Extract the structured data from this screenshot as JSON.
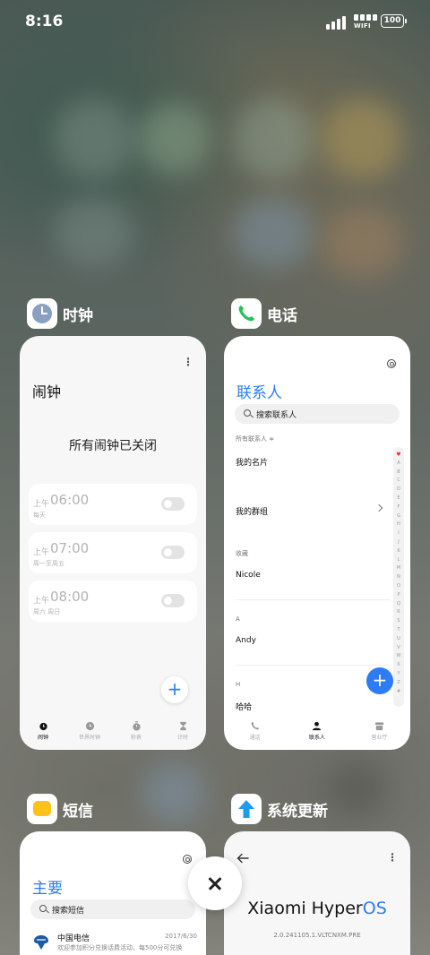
{
  "status_bar": {
    "time": "8:16",
    "wifi_label": "WIFI",
    "battery": "100"
  },
  "apps": [
    {
      "name": "时钟",
      "title": "闹钟",
      "empty_state": "所有闹钟已关闭",
      "alarms": [
        {
          "ampm": "上午",
          "time": "06:00",
          "repeat": "每天",
          "enabled": false
        },
        {
          "ampm": "上午",
          "time": "07:00",
          "repeat": "周一至周五",
          "enabled": false
        },
        {
          "ampm": "上午",
          "time": "08:00",
          "repeat": "周六 周日",
          "enabled": false
        }
      ],
      "fab": "+",
      "tabs": [
        "闹钟",
        "世界时钟",
        "秒表",
        "计时"
      ],
      "active_tab": "闹钟"
    },
    {
      "name": "电话",
      "title": "联系人",
      "search_placeholder": "搜索联系人",
      "filter": "所有联系人 ≑",
      "my_card": "我的名片",
      "my_groups": "我的群组",
      "sections": [
        {
          "header": "收藏",
          "contact": "Nicole"
        },
        {
          "header": "A",
          "contact": "Andy"
        },
        {
          "header": "H",
          "contact": "哈哈"
        }
      ],
      "alphabet": [
        "♥",
        "A",
        "B",
        "C",
        "D",
        "E",
        "F",
        "G",
        "H",
        "I",
        "J",
        "K",
        "L",
        "M",
        "N",
        "O",
        "P",
        "Q",
        "R",
        "S",
        "T",
        "U",
        "V",
        "W",
        "X",
        "Y",
        "Z",
        "#"
      ],
      "fab": "+",
      "tabs": [
        "通话",
        "联系人",
        "营业厅"
      ],
      "active_tab": "联系人"
    },
    {
      "name": "短信",
      "title": "主要",
      "search_placeholder": "搜索短信",
      "message": {
        "sender": "中国电信",
        "date": "2017/6/30",
        "preview": "欢迎参加积分兑换话费活动，每500分可兑换"
      }
    },
    {
      "name": "系统更新",
      "brand_prefix": "Xiaomi Hyper",
      "brand_suffix": "OS",
      "version": "2.0.241105.1.VLTCNXM.PRE"
    }
  ],
  "close_button": "close-icon",
  "colors": {
    "accent": "#2d7cf6",
    "phone_green": "#26c15a",
    "sms_yellow": "#ffc21a",
    "update_blue": "#1e9bf0"
  }
}
